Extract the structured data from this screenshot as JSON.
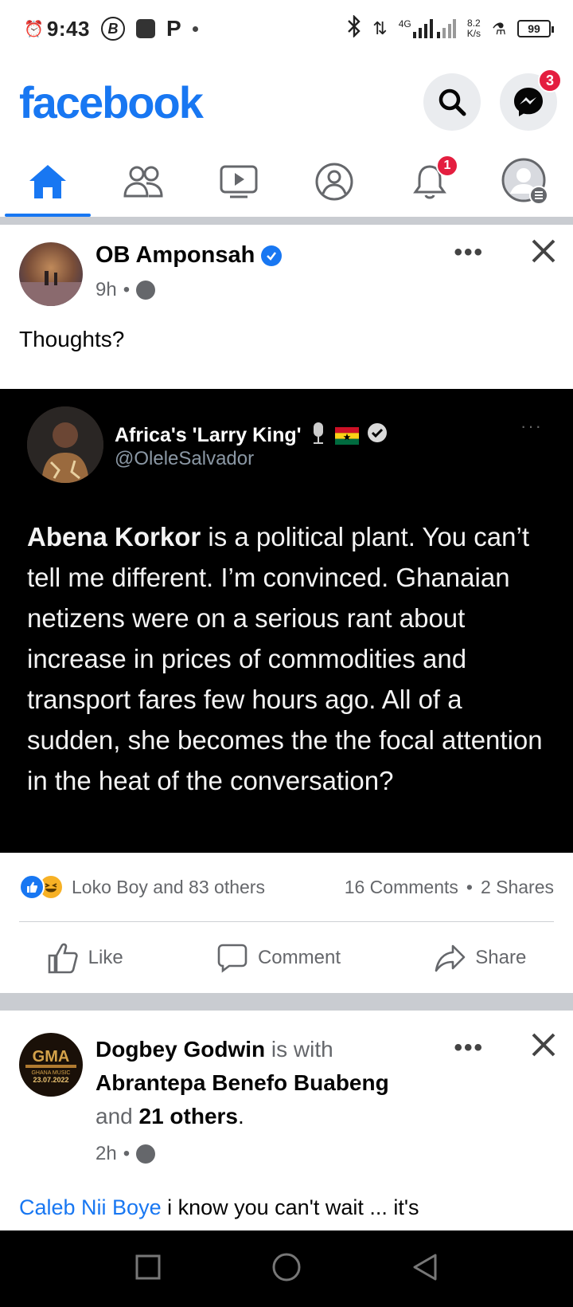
{
  "status_bar": {
    "time": "9:43",
    "icon_b": "B",
    "icon_p": "P",
    "network_speed_top": "8.2",
    "network_speed_unit": "K/s",
    "network_type": "4G",
    "battery": "99"
  },
  "header": {
    "logo": "facebook",
    "messenger_badge": "3"
  },
  "tabs": {
    "notifications_badge": "1"
  },
  "post1": {
    "author": "OB Amponsah",
    "time": "9h",
    "dot": "•",
    "text": "Thoughts?",
    "tweet": {
      "name": "Africa's 'Larry King'",
      "handle": "@OleleSalvador",
      "body_bold": "Abena Korkor",
      "body_rest": " is a political plant. You can’t tell me different. I’m convinced. Ghanaian netizens were on a serious rant about increase in prices of commodities and transport fares few hours ago. All of a sudden, she becomes the the focal attention in the heat of the conversation?",
      "more": "···"
    },
    "reactions_text": "Loko Boy and 83 others",
    "comments_text": "16 Comments",
    "shares_text": "2 Shares",
    "actions": {
      "like": "Like",
      "comment": "Comment",
      "share": "Share"
    },
    "more": "•••"
  },
  "post2": {
    "author": "Dogbey Godwin",
    "with_text": " is with ",
    "tagged": "Abrantepa Benefo Buabeng",
    "and_text": "and ",
    "others": "21 others",
    "period": ".",
    "time": "2h",
    "avatar_text": "GHANA MUSIC",
    "avatar_date": "23.07.2022",
    "mention": "Caleb Nii Boye",
    "text": " i know you can't wait ... it's",
    "more": "•••"
  }
}
